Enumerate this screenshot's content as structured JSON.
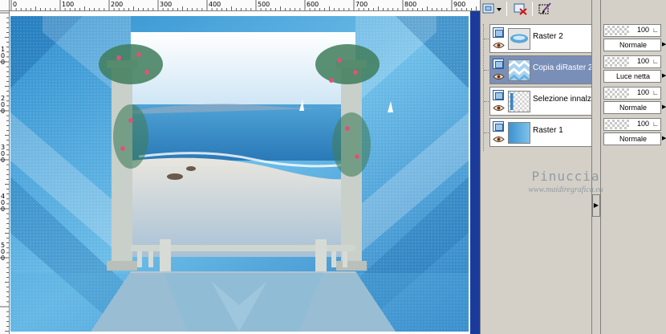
{
  "ruler": {
    "top_labels": [
      "0",
      "100",
      "200",
      "300",
      "400",
      "500",
      "600",
      "700",
      "800",
      "900"
    ],
    "left_labels": [
      "1",
      "0",
      "0",
      "2",
      "0",
      "0",
      "3",
      "0",
      "0",
      "4",
      "0",
      "0",
      "5",
      "0",
      "0"
    ]
  },
  "toolbar": {
    "new_layer_icon": "new-layer-icon",
    "delete_layer_icon": "delete-layer-icon",
    "edit_icon": "edit-icon"
  },
  "layers": [
    {
      "name": "Raster 2",
      "opacity": "100",
      "blend": "Normale",
      "selected": false,
      "thumb": "lens"
    },
    {
      "name": "Copia diRaster 2",
      "opacity": "100",
      "blend": "Luce netta",
      "selected": true,
      "thumb": "zigzag"
    },
    {
      "name": "Selezione innalzata",
      "opacity": "100",
      "blend": "Normale",
      "selected": false,
      "thumb": "selection"
    },
    {
      "name": "Raster 1",
      "opacity": "100",
      "blend": "Normale",
      "selected": false,
      "thumb": "gradient"
    }
  ],
  "watermark": {
    "name": "Pinuccia",
    "url": "www.maidiregrafica.eu"
  },
  "colors": {
    "selection": "#7a8fb8",
    "scrollbar": "#1a3a9c",
    "sky_blue": "#4aa6db"
  }
}
